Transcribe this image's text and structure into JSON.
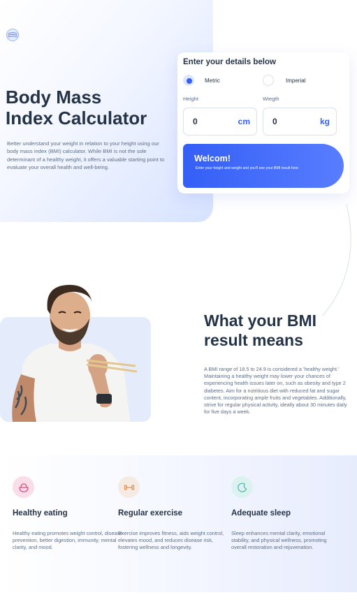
{
  "hero": {
    "title_line1": "Body Mass",
    "title_line2": "Index Calculator",
    "text": "Better understand your weight in relation to your height using our body mass index (BMI) calculator. While BMI is not the sole determinant of a healthy weight, it offers a valuable starting point to evaluate your overall health and well-being.",
    "logo_icon": "bmi-logo-icon"
  },
  "calculator": {
    "title": "Enter your details below",
    "units": [
      {
        "label": "Metric",
        "selected": true
      },
      {
        "label": "Imperial",
        "selected": false
      }
    ],
    "height": {
      "label": "Height",
      "value": "0",
      "unit": "cm"
    },
    "weight": {
      "label": "Wiegth",
      "value": "0",
      "unit": "kg"
    },
    "result": {
      "title": "Welcom!",
      "text": "Enter your height and weight and you'll see your BMI result here"
    }
  },
  "meaning": {
    "title_line1": "What your BMI",
    "title_line2": "result means",
    "text": "A BMI range of 18.5 to 24.9 is considered a 'healthy weight.' Maintaining a healthy weight may lower your chances of experiencing health issues later on, such as obesity and type 2 diabetes. Aim for a nutritious diet with reduced fat and sugar content, incorporating ample fruits and vegetables. Additionally, strive for regular physical activity, ideally about 30 minutes daily for five days a week."
  },
  "tips": [
    {
      "icon": "food-bowl-icon",
      "title": "Healthy eating",
      "text": "Healthy eating promotes weight control, disease prevention, better digestion, immunity, mental clarity, and mood."
    },
    {
      "icon": "dumbbell-icon",
      "title": "Regular exercise",
      "text": "Exercise improves fitness, aids weight control, elevates mood, and reduces disease risk, fostering wellness and longevity."
    },
    {
      "icon": "moon-icon",
      "title": "Adequate sleep",
      "text": "Sleep enhances mental clarity, emotional stability, and physical wellness, promoting overall restoration and rejuvenation."
    }
  ],
  "colors": {
    "primary_blue": "#345ff6",
    "heading": "#253347",
    "body_text": "#5e6e85",
    "border": "#d8e2e7",
    "eating_icon_bg": "#f9dde8",
    "exercise_icon_bg": "#f6ebe2",
    "sleep_icon_bg": "#dcf2f1"
  }
}
